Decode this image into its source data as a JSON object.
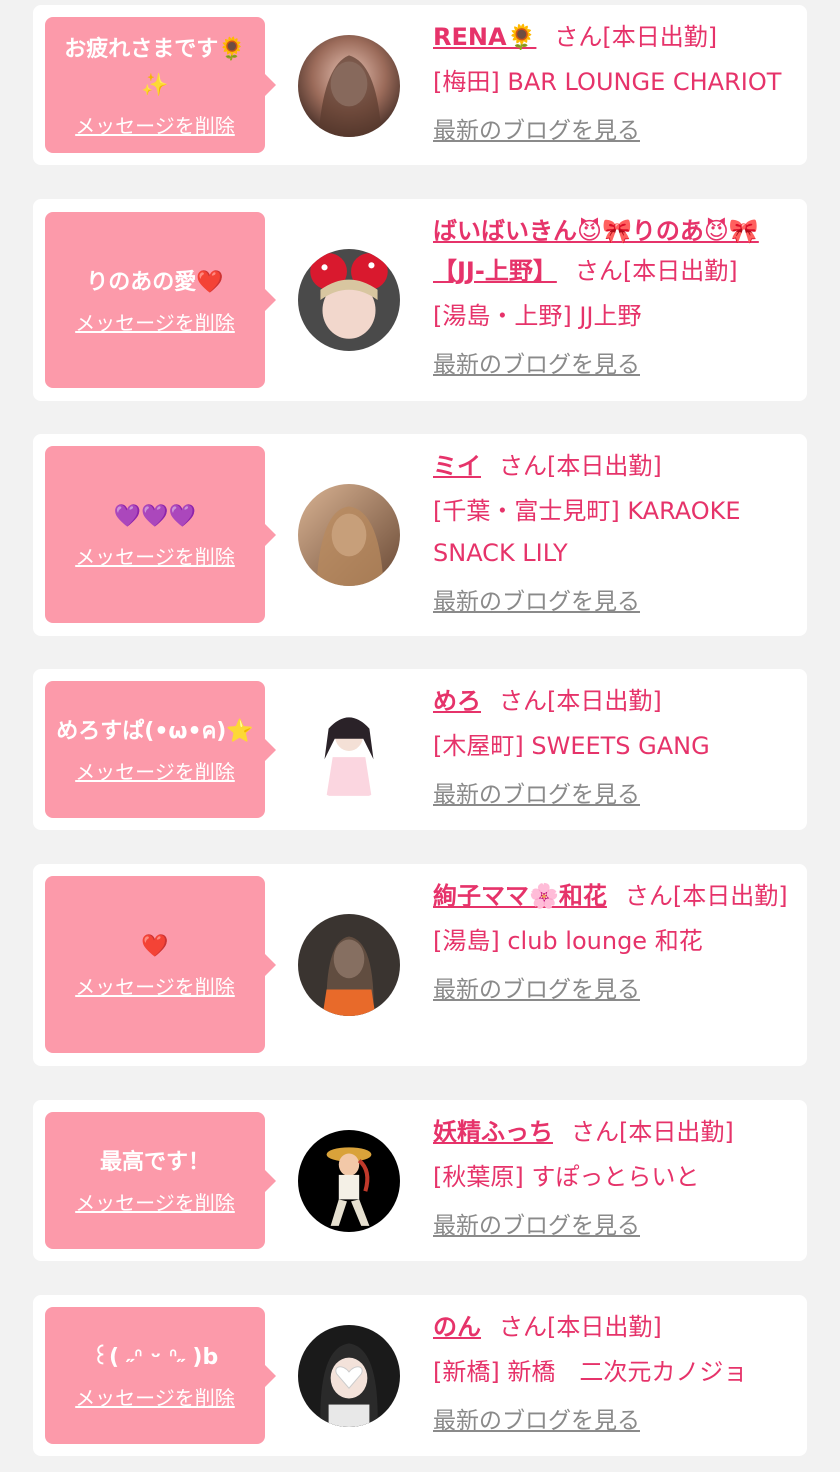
{
  "items": [
    {
      "message": "お疲れさまです🌻✨",
      "delete_label": "メッセージを削除",
      "name": "RENA🌻",
      "status": "さん[本日出勤]",
      "shop": "[梅田] BAR LOUNGE CHARIOT",
      "blog_label": "最新のブログを見る"
    },
    {
      "message": "りのあの愛❤️",
      "delete_label": "メッセージを削除",
      "name": "ばいばいきん😈🎀りのあ😈🎀【JJ-上野】",
      "status": "さん[本日出勤]",
      "shop": "[湯島・上野] JJ上野",
      "blog_label": "最新のブログを見る"
    },
    {
      "message": "💜💜💜",
      "delete_label": "メッセージを削除",
      "name": "ミイ",
      "status": "さん[本日出勤]",
      "shop": "[千葉・富士見町] KARAOKE SNACK LILY",
      "blog_label": "最新のブログを見る"
    },
    {
      "message": "めろすぱ(•ω•ค)⭐️",
      "delete_label": "メッセージを削除",
      "name": "めろ",
      "status": "さん[本日出勤]",
      "shop": "[木屋町] SWEETS GANG",
      "blog_label": "最新のブログを見る"
    },
    {
      "message": "❤️",
      "delete_label": "メッセージを削除",
      "name": "絢子ママ🌸和花",
      "status": "さん[本日出勤]",
      "shop": "[湯島] club lounge 和花",
      "blog_label": "最新のブログを見る"
    },
    {
      "message": "最高です！",
      "delete_label": "メッセージを削除",
      "name": "妖精ふっち",
      "status": "さん[本日出勤]",
      "shop": "[秋葉原] すぽっとらいと",
      "blog_label": "最新のブログを見る"
    },
    {
      "message": "꒰( ˶ᐢ ᵕ ᐢ˶ )b",
      "delete_label": "メッセージを削除",
      "name": "のん",
      "status": "さん[本日出勤]",
      "shop": "[新橋] 新橋　二次元カノジョ",
      "blog_label": "最新のブログを見る"
    }
  ],
  "colors": {
    "accent": "#e6336a",
    "bubble": "#fc9aaa",
    "link_gray": "#8a8a8a",
    "background": "#f2f2f2"
  }
}
